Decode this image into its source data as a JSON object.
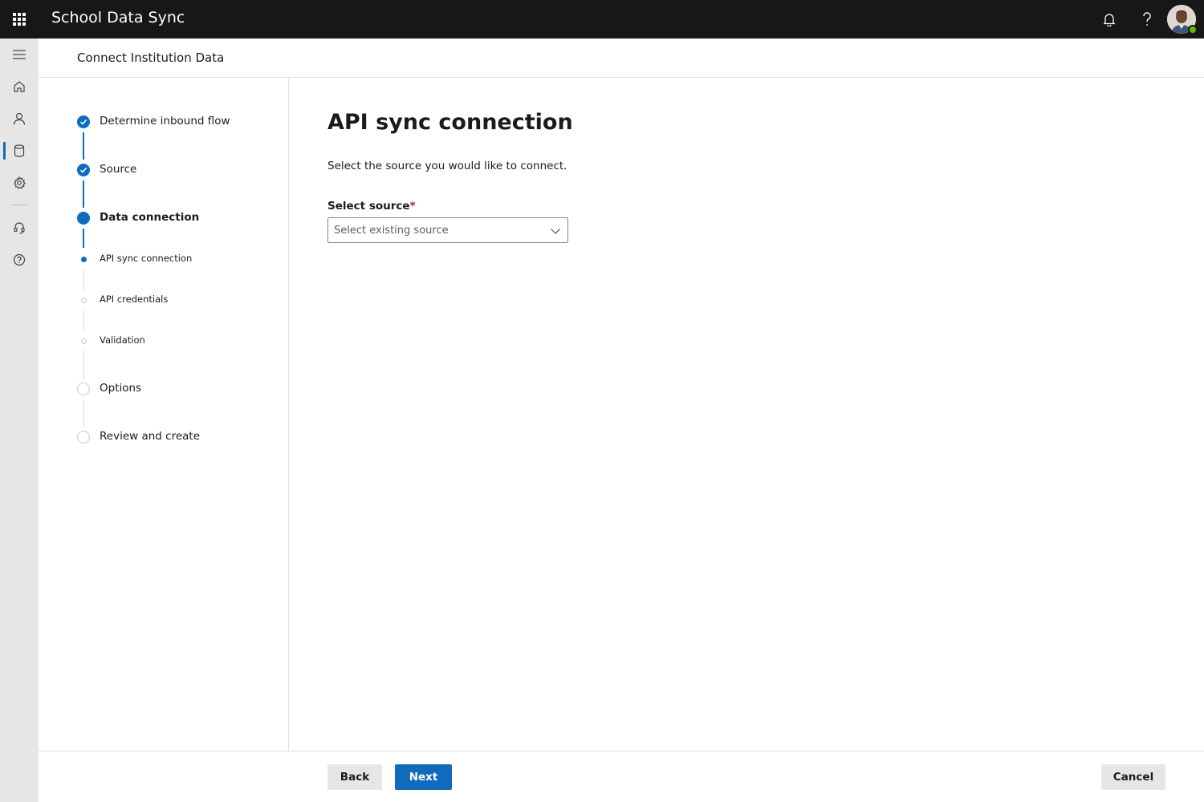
{
  "app": {
    "title": "School Data Sync"
  },
  "header": {
    "page_title": "Connect Institution Data"
  },
  "steps": {
    "items": [
      {
        "label": "Determine inbound flow",
        "state": "done"
      },
      {
        "label": "Source",
        "state": "done"
      },
      {
        "label": "Data connection",
        "state": "current"
      },
      {
        "label": "API sync connection",
        "state": "current-sub"
      },
      {
        "label": "API credentials",
        "state": "pending-sub"
      },
      {
        "label": "Validation",
        "state": "pending-sub"
      },
      {
        "label": "Options",
        "state": "pending"
      },
      {
        "label": "Review and create",
        "state": "pending"
      }
    ]
  },
  "main": {
    "heading": "API sync connection",
    "description": "Select the source you would like to connect.",
    "select_label": "Select source",
    "required_mark": "*",
    "select_placeholder": "Select existing source"
  },
  "footer": {
    "back_label": "Back",
    "next_label": "Next",
    "cancel_label": "Cancel"
  },
  "colors": {
    "topbar_bg": "#171717",
    "accent": "#0f6cbd",
    "rail_bg": "#e6e6e6",
    "presence": "#6bb700",
    "required": "#c50f1f"
  },
  "icons": {
    "topbar": [
      "waffle-icon",
      "bell-icon",
      "help-icon",
      "avatar"
    ],
    "rail": [
      "hamburger-icon",
      "home-icon",
      "person-icon",
      "database-icon",
      "settings-icon",
      "headset-icon",
      "help-circle-icon"
    ]
  }
}
